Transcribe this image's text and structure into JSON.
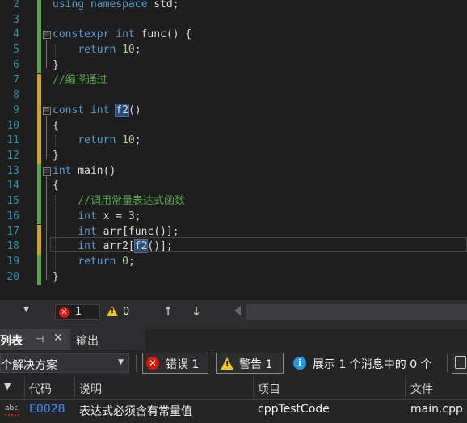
{
  "editor": {
    "lines": [
      {
        "num": "2",
        "mark": "green",
        "fold": "",
        "segments": [
          {
            "t": "using namespace",
            "c": "kw"
          },
          {
            "t": " std;",
            "c": ""
          }
        ]
      },
      {
        "num": "3",
        "mark": "green",
        "fold": "",
        "segments": []
      },
      {
        "num": "4",
        "mark": "green",
        "fold": "⊟",
        "segments": [
          {
            "t": "constexpr",
            "c": "kw"
          },
          {
            "t": " ",
            "c": ""
          },
          {
            "t": "int",
            "c": "kw"
          },
          {
            "t": " func() {",
            "c": ""
          }
        ]
      },
      {
        "num": "5",
        "mark": "green",
        "fold": "",
        "segments": [
          {
            "t": "    ",
            "c": ""
          },
          {
            "t": "return",
            "c": "kw"
          },
          {
            "t": " ",
            "c": ""
          },
          {
            "t": "10",
            "c": "num"
          },
          {
            "t": ";",
            "c": ""
          }
        ]
      },
      {
        "num": "6",
        "mark": "green",
        "fold": "",
        "segments": [
          {
            "t": "}",
            "c": ""
          }
        ]
      },
      {
        "num": "7",
        "mark": "yellow",
        "fold": "",
        "segments": [
          {
            "t": "//编译通过",
            "c": "cmt"
          }
        ]
      },
      {
        "num": "8",
        "mark": "yellow",
        "fold": "",
        "segments": []
      },
      {
        "num": "9",
        "mark": "yellow",
        "fold": "⊟",
        "segments": [
          {
            "t": "const",
            "c": "kw"
          },
          {
            "t": " ",
            "c": ""
          },
          {
            "t": "int",
            "c": "kw"
          },
          {
            "t": " ",
            "c": ""
          },
          {
            "t": "f2",
            "c": "hl"
          },
          {
            "t": "()",
            "c": ""
          }
        ]
      },
      {
        "num": "10",
        "mark": "yellow",
        "fold": "",
        "segments": [
          {
            "t": "{",
            "c": ""
          }
        ]
      },
      {
        "num": "11",
        "mark": "yellow",
        "fold": "",
        "segments": [
          {
            "t": "    ",
            "c": ""
          },
          {
            "t": "return",
            "c": "kw"
          },
          {
            "t": " ",
            "c": ""
          },
          {
            "t": "10",
            "c": "num"
          },
          {
            "t": ";",
            "c": ""
          }
        ]
      },
      {
        "num": "12",
        "mark": "yellow",
        "fold": "",
        "segments": [
          {
            "t": "}",
            "c": ""
          }
        ]
      },
      {
        "num": "13",
        "mark": "green",
        "fold": "⊟",
        "segments": [
          {
            "t": "int",
            "c": "kw"
          },
          {
            "t": " main()",
            "c": ""
          }
        ]
      },
      {
        "num": "14",
        "mark": "green",
        "fold": "",
        "segments": [
          {
            "t": "{",
            "c": ""
          }
        ]
      },
      {
        "num": "15",
        "mark": "green",
        "fold": "",
        "segments": [
          {
            "t": "    ",
            "c": ""
          },
          {
            "t": "//调用常量表达式函数",
            "c": "cmt"
          }
        ]
      },
      {
        "num": "16",
        "mark": "green",
        "fold": "",
        "segments": [
          {
            "t": "    ",
            "c": ""
          },
          {
            "t": "int",
            "c": "kw"
          },
          {
            "t": " x = ",
            "c": ""
          },
          {
            "t": "3",
            "c": "num"
          },
          {
            "t": ";",
            "c": ""
          }
        ]
      },
      {
        "num": "17",
        "mark": "yellow",
        "fold": "",
        "segments": [
          {
            "t": "    ",
            "c": ""
          },
          {
            "t": "int",
            "c": "kw"
          },
          {
            "t": " arr[func()];",
            "c": ""
          }
        ]
      },
      {
        "num": "18",
        "mark": "yellow",
        "fold": "",
        "segments": [
          {
            "t": "    ",
            "c": ""
          },
          {
            "t": "int",
            "c": "kw"
          },
          {
            "t": " arr2[",
            "c": ""
          },
          {
            "t": "f2",
            "c": "hl squig"
          },
          {
            "t": "()];",
            "c": ""
          }
        ]
      },
      {
        "num": "19",
        "mark": "green",
        "fold": "",
        "segments": [
          {
            "t": "    ",
            "c": ""
          },
          {
            "t": "return",
            "c": "kw"
          },
          {
            "t": " ",
            "c": ""
          },
          {
            "t": "0",
            "c": "num"
          },
          {
            "t": ";",
            "c": ""
          }
        ]
      },
      {
        "num": "20",
        "mark": "green",
        "fold": "",
        "segments": [
          {
            "t": "}",
            "c": ""
          }
        ]
      }
    ]
  },
  "status": {
    "errors": "1",
    "warnings": "0",
    "nav_up": "↑",
    "nav_down": "↓"
  },
  "panel": {
    "tab_active_label": "列表",
    "tab_output_label": "输出",
    "pin_icon": "⊣",
    "close_icon": "✕",
    "scope_label": "个解决方案",
    "filter_errors": "错误 1",
    "filter_warnings": "警告 1",
    "filter_messages": "展示 1 个消息中的 0 个"
  },
  "table": {
    "headers": [
      "代码",
      "说明",
      "项目",
      "文件"
    ],
    "rows": [
      {
        "icon": "abc",
        "code": "E0028",
        "desc": "表达式必须含有常量值",
        "project": "cppTestCode",
        "file": "main.cpp"
      }
    ]
  },
  "colors": {
    "background": "#1e1e1e",
    "keyword": "#569cd6",
    "comment": "#57a64a",
    "number": "#b5cea8",
    "error": "#e51400",
    "warning": "#f5c518",
    "info": "#1c97ea"
  }
}
